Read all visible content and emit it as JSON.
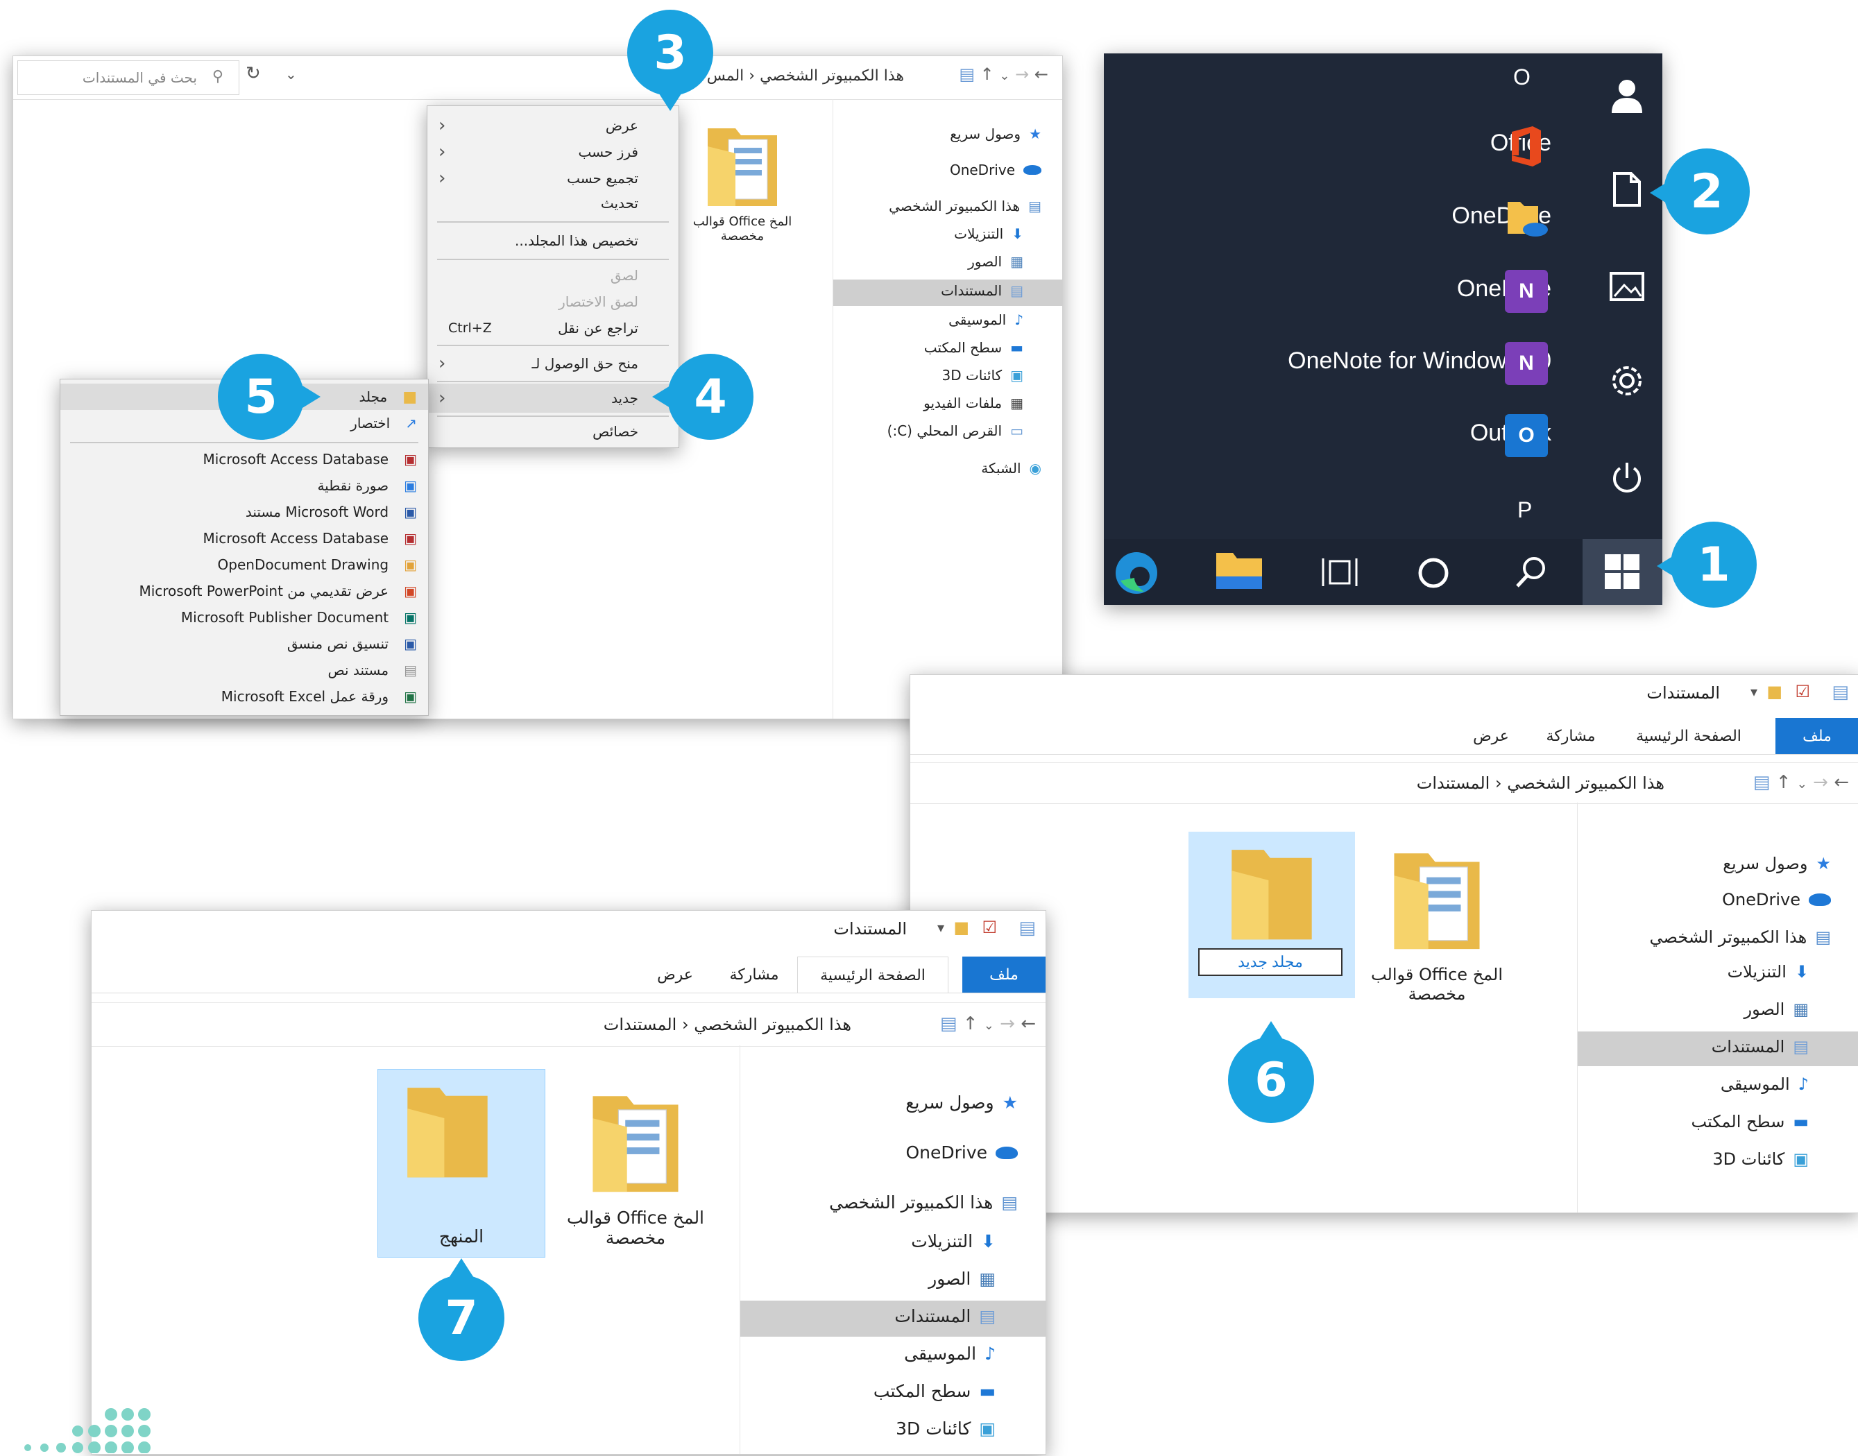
{
  "callouts": [
    "1",
    "2",
    "3",
    "4",
    "5",
    "6",
    "7"
  ],
  "start_menu": {
    "letter_o": "O",
    "letter_p": "P",
    "apps": [
      {
        "label": "Office",
        "tile_color": "#e8491d",
        "tile_letter": ""
      },
      {
        "label": "OneDrive",
        "tile_color": "#f4c04a",
        "tile_letter": ""
      },
      {
        "label": "OneNote",
        "tile_color": "#7b3fb8",
        "tile_letter": "N"
      },
      {
        "label": "OneNote for Windows 10",
        "tile_color": "#7b3fb8",
        "tile_letter": "N"
      },
      {
        "label": "Outlook",
        "tile_color": "#1976d2",
        "tile_letter": "O"
      }
    ],
    "side_icons": [
      "user-icon",
      "document-icon",
      "pictures-icon",
      "settings-icon",
      "power-icon"
    ],
    "taskbar_icons": [
      "edge-icon",
      "file-explorer-icon",
      "task-view-icon",
      "cortana-icon",
      "search-icon",
      "windows-start-icon"
    ]
  },
  "explorer1": {
    "search_placeholder": "بحث في المستندات",
    "breadcrumb": [
      "هذا الكمبيوتر الشخصي",
      "المس"
    ],
    "nav": [
      "وصول سريع",
      "OneDrive",
      "هذا الكمبيوتر الشخصي",
      "التنزيلات",
      "الصور",
      "المستندات",
      "الموسيقى",
      "سطح المكتب",
      "كائنات 3D",
      "ملفات الفيديو",
      "القرص المحلي (C:)",
      "الشبكة"
    ],
    "folder_label": "المخ Office قوالب مخصصة",
    "context_menu": [
      {
        "label": "عرض",
        "shortcut": "",
        "submenu": true,
        "disabled": false
      },
      {
        "label": "فرز حسب",
        "shortcut": "",
        "submenu": true,
        "disabled": false
      },
      {
        "label": "تجميع حسب",
        "shortcut": "",
        "submenu": true,
        "disabled": false
      },
      {
        "label": "تحديث",
        "shortcut": "",
        "submenu": false,
        "disabled": false
      },
      {
        "label": "تخصيص هذا المجلد...",
        "shortcut": "",
        "submenu": false,
        "disabled": false
      },
      {
        "label": "لصق",
        "shortcut": "",
        "submenu": false,
        "disabled": true
      },
      {
        "label": "لصق الاختصار",
        "shortcut": "",
        "submenu": false,
        "disabled": true
      },
      {
        "label": "تراجع عن نقل",
        "shortcut": "Ctrl+Z",
        "submenu": false,
        "disabled": false
      },
      {
        "label": "منح حق الوصول لـ",
        "shortcut": "",
        "submenu": true,
        "disabled": false
      },
      {
        "label": "جديد",
        "shortcut": "",
        "submenu": true,
        "disabled": false
      },
      {
        "label": "خصائص",
        "shortcut": "",
        "submenu": false,
        "disabled": false
      }
    ],
    "new_submenu": [
      "مجلد",
      "اختصار",
      "Microsoft Access Database",
      "صورة نقطية",
      "Microsoft Word مستند",
      "Microsoft Access Database",
      "OpenDocument Drawing",
      "عرض تقديمي من Microsoft PowerPoint",
      "Microsoft Publisher Document",
      "تنسيق نص منسق",
      "مستند نص",
      "ورقة عمل Microsoft Excel"
    ]
  },
  "explorer2": {
    "title": "المستندات",
    "tabs": [
      "ملف",
      "الصفحة الرئيسية",
      "مشاركة",
      "عرض"
    ],
    "breadcrumb": [
      "هذا الكمبيوتر الشخصي",
      "المستندات"
    ],
    "nav": [
      "وصول سريع",
      "OneDrive",
      "هذا الكمبيوتر الشخصي",
      "التنزيلات",
      "الصور",
      "المستندات",
      "الموسيقى",
      "سطح المكتب",
      "كائنات 3D"
    ],
    "folder1_label": "المخ Office قوالب مخصصة",
    "new_folder_value": "مجلد جديد"
  },
  "explorer3": {
    "title": "المستندات",
    "tabs": [
      "ملف",
      "الصفحة الرئيسية",
      "مشاركة",
      "عرض"
    ],
    "breadcrumb": [
      "هذا الكمبيوتر الشخصي",
      "المستندات"
    ],
    "nav": [
      "وصول سريع",
      "OneDrive",
      "هذا الكمبيوتر الشخصي",
      "التنزيلات",
      "الصور",
      "المستندات",
      "الموسيقى",
      "سطح المكتب",
      "كائنات 3D"
    ],
    "folder1_label": "المخ Office قوالب مخصصة",
    "folder2_label": "المنهج"
  }
}
